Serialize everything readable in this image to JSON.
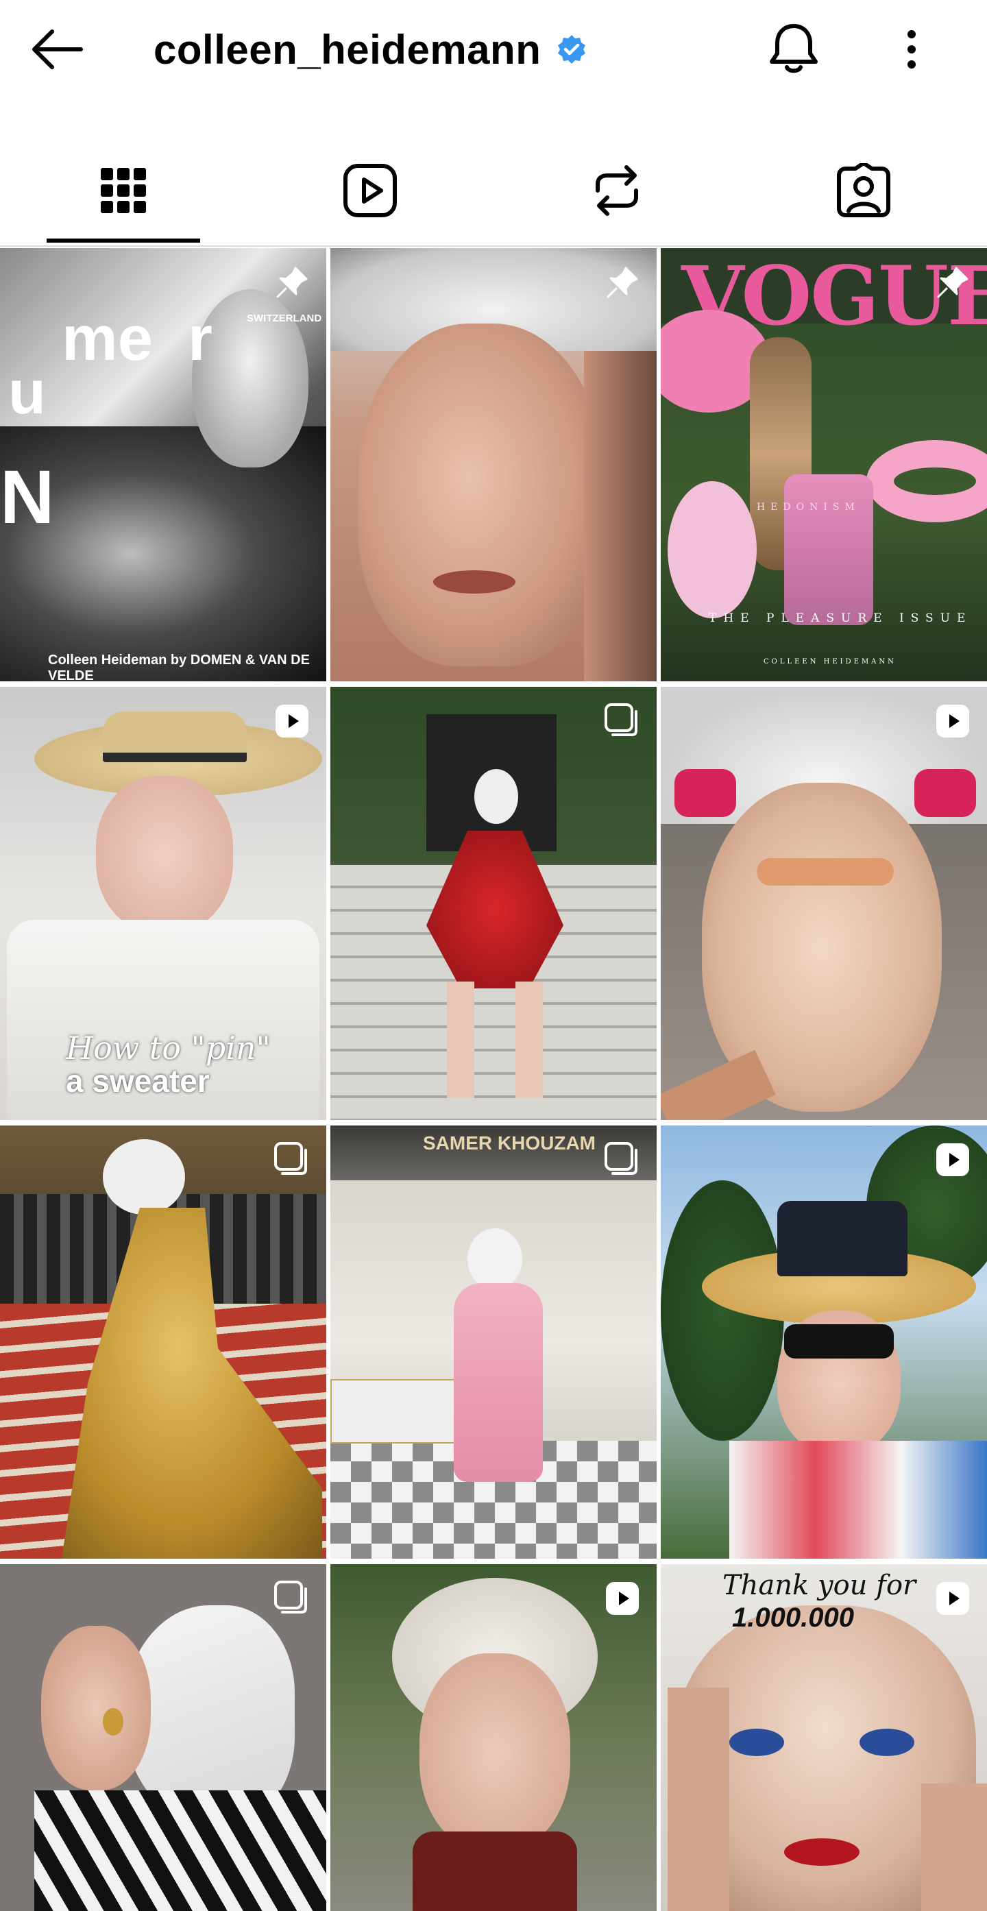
{
  "header": {
    "username": "colleen_heidemann",
    "verified_icon": "verified-badge-icon",
    "back_icon": "arrow-left-icon",
    "bell_icon": "bell-icon",
    "more_icon": "more-vertical-icon",
    "verified_color": "#3897f0"
  },
  "tabs": [
    {
      "name": "posts",
      "icon": "grid-icon",
      "active": true
    },
    {
      "name": "reels",
      "icon": "reels-icon",
      "active": false
    },
    {
      "name": "reposts",
      "icon": "repost-icon",
      "active": false
    },
    {
      "name": "tagged",
      "icon": "tagged-person-icon",
      "active": false
    }
  ],
  "posts": [
    {
      "badge": "pin-icon",
      "caption": "Colleen Heideman by DOMEN & VAN DE VELDE",
      "overlay_letters": [
        "u",
        "m",
        "e",
        "r",
        "N"
      ],
      "corner_text": "SWITZERLAND"
    },
    {
      "badge": "pin-icon"
    },
    {
      "badge": "pin-icon",
      "masthead": "VOGUE",
      "footer_text": "THE PLEASURE ISSUE",
      "name_text": "COLLEEN HEIDEMANN",
      "mid_text": "HEDONISM"
    },
    {
      "badge": "reel-icon",
      "caption_line1": "How to \"pin\"",
      "caption_line2": "a sweater"
    },
    {
      "badge": "carousel-icon"
    },
    {
      "badge": "reel-icon"
    },
    {
      "badge": "carousel-icon"
    },
    {
      "badge": "carousel-icon",
      "store_sign": "SAMER KHOUZAM"
    },
    {
      "badge": "reel-icon"
    },
    {
      "badge": "carousel-icon"
    },
    {
      "badge": "reel-icon"
    },
    {
      "badge": "reel-icon",
      "caption_line1": "Thank you for",
      "caption_line2": "1.000.000"
    }
  ]
}
